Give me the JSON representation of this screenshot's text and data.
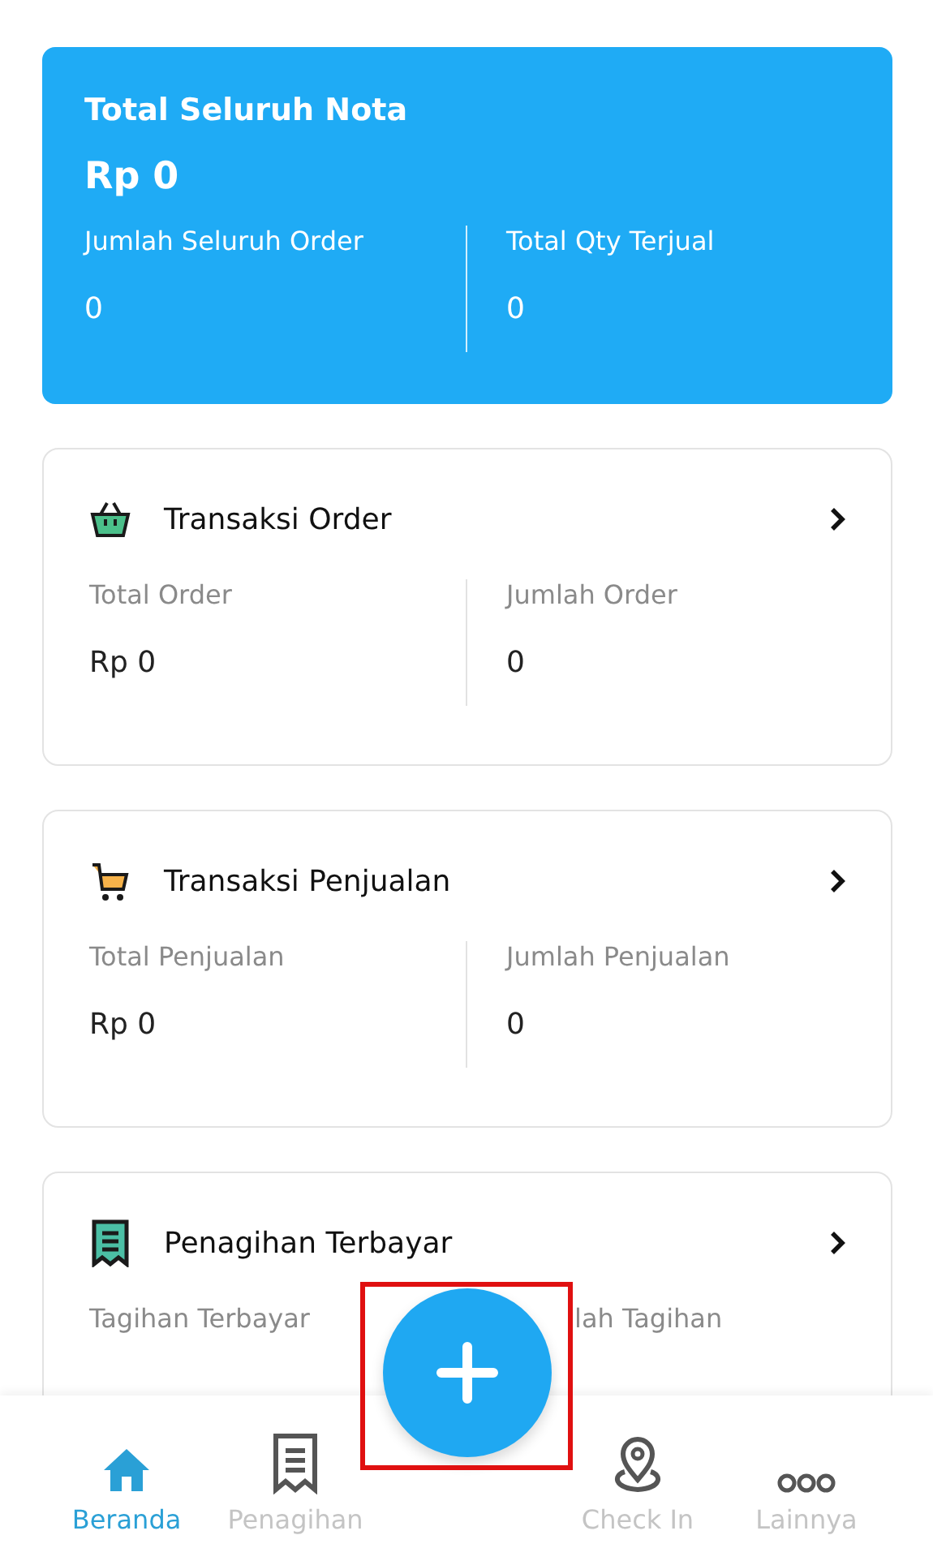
{
  "summary": {
    "title": "Total Seluruh Nota",
    "amount": "Rp 0",
    "stats": [
      {
        "label": "Jumlah Seluruh Order",
        "value": "0"
      },
      {
        "label": "Total Qty Terjual",
        "value": "0"
      }
    ]
  },
  "cards": [
    {
      "kind": "basket",
      "title": "Transaksi Order",
      "stats": [
        {
          "label": "Total Order",
          "value": "Rp 0"
        },
        {
          "label": "Jumlah Order",
          "value": "0"
        }
      ]
    },
    {
      "kind": "cart",
      "title": "Transaksi Penjualan",
      "stats": [
        {
          "label": "Total Penjualan",
          "value": "Rp 0"
        },
        {
          "label": "Jumlah Penjualan",
          "value": "0"
        }
      ]
    },
    {
      "kind": "receipt",
      "title": "Penagihan Terbayar",
      "stats": [
        {
          "label": "Tagihan Terbayar"
        },
        {
          "label": "lah Tagihan",
          "covered": true
        }
      ]
    }
  ],
  "fab": {
    "highlighted": true
  },
  "nav": [
    {
      "kind": "home",
      "label": "Beranda",
      "selected": true
    },
    {
      "kind": "receipt",
      "label": "Penagihan",
      "selected": false
    },
    {
      "kind": "gap"
    },
    {
      "kind": "pin",
      "label": "Check In",
      "selected": false
    },
    {
      "kind": "more",
      "label": "Lainnya",
      "selected": false
    }
  ]
}
